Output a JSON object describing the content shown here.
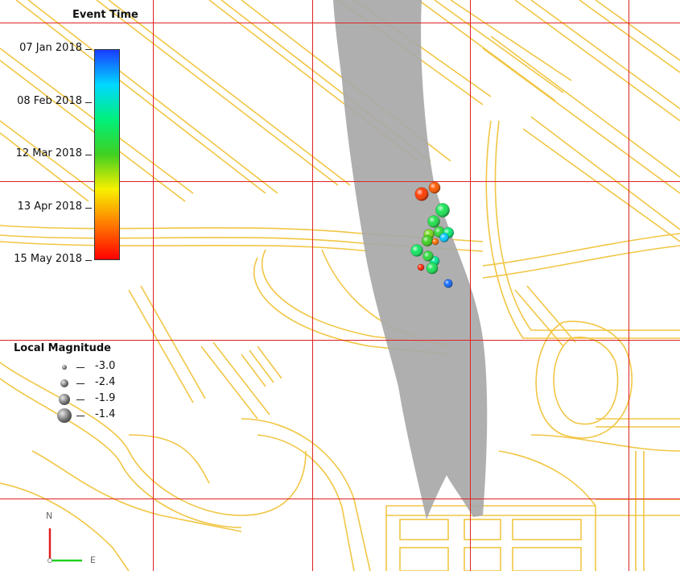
{
  "legend_time": {
    "title": "Event Time",
    "ticks": [
      "07 Jan 2018",
      "08 Feb 2018",
      "12 Mar 2018",
      "13 Apr 2018",
      "15 May 2018"
    ],
    "gradient_colors": [
      "#1a3cff",
      "#00d8ff",
      "#00f07a",
      "#40d020",
      "#f8f000",
      "#ff7a00",
      "#ff0000"
    ]
  },
  "legend_magnitude": {
    "title": "Local Magnitude",
    "entries": [
      "-3.0",
      "-2.4",
      "-1.9",
      "-1.4"
    ]
  },
  "axes": {
    "north": "N",
    "east": "E",
    "north_color": "#e02020",
    "east_color": "#20d020"
  },
  "colors": {
    "grid": "#dd2222",
    "roads": "#f0c030",
    "fault_surface": "#a8a8a8"
  },
  "events": [
    {
      "time_fraction": 0.92,
      "magnitude": -1.6
    },
    {
      "time_fraction": 0.88,
      "magnitude": -1.9
    },
    {
      "time_fraction": 0.4,
      "magnitude": -1.5
    },
    {
      "time_fraction": 0.42,
      "magnitude": -1.8
    },
    {
      "time_fraction": 0.45,
      "magnitude": -2.0
    },
    {
      "time_fraction": 0.35,
      "magnitude": -2.0
    },
    {
      "time_fraction": 0.55,
      "magnitude": -2.1
    },
    {
      "time_fraction": 0.5,
      "magnitude": -2.0
    },
    {
      "time_fraction": 0.3,
      "magnitude": -2.2
    },
    {
      "time_fraction": 0.85,
      "magnitude": -2.7
    },
    {
      "time_fraction": 0.15,
      "magnitude": -2.3
    },
    {
      "time_fraction": 0.45,
      "magnitude": -2.1
    },
    {
      "time_fraction": 0.4,
      "magnitude": -1.9
    },
    {
      "time_fraction": 0.38,
      "magnitude": -1.8
    },
    {
      "time_fraction": 0.95,
      "magnitude": -2.7
    },
    {
      "time_fraction": 0.05,
      "magnitude": -2.4
    }
  ]
}
